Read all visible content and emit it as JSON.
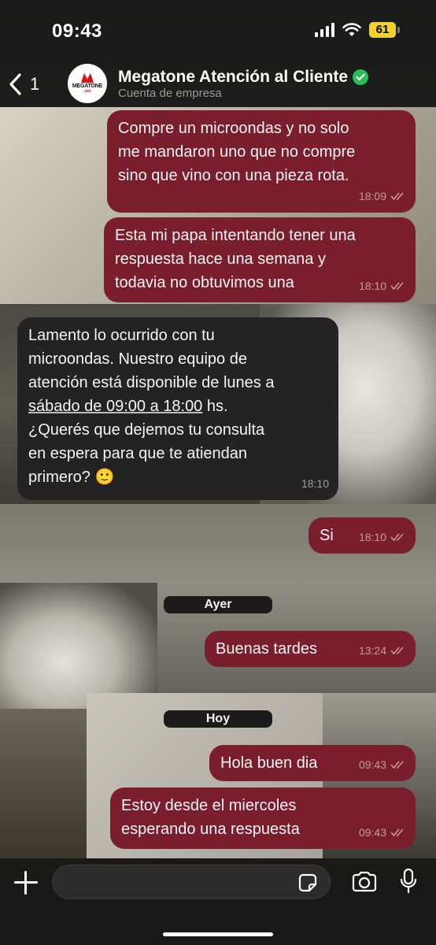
{
  "status": {
    "time": "09:43",
    "battery": "61"
  },
  "header": {
    "back_count": "1",
    "avatar_text": "MEGATONE",
    "avatar_sub": ".net",
    "name": "Megatone Atención al Cliente",
    "subtitle": "Cuenta de empresa"
  },
  "messages": [
    {
      "dir": "out",
      "text_lines": [
        "Compre un microondas y no solo",
        "me mandaron uno que no compre",
        "sino que vino con una pieza rota."
      ],
      "time": "18:09"
    },
    {
      "dir": "out",
      "text_lines": [
        "Esta mi papa intentando tener una",
        "respuesta hace una semana y",
        "todavia no obtuvimos una"
      ],
      "time": "18:10"
    },
    {
      "dir": "in",
      "text_lines": [
        "Lamento lo ocurrido con tu",
        "microondas. Nuestro equipo de",
        "atención está disponible de lunes a",
        "sábado de 09:00 a 18:00",
        "hs.",
        "¿Querés que dejemos tu consulta",
        "en espera para que te atiendan",
        "primero?",
        "🙂"
      ],
      "time": "18:10"
    },
    {
      "dir": "out",
      "text": "Si",
      "time": "18:10"
    },
    {
      "dir": "out",
      "text": "Buenas tardes",
      "time": "13:24"
    },
    {
      "dir": "out",
      "text": "Hola buen dia",
      "time": "09:43"
    },
    {
      "dir": "out",
      "text_lines": [
        "Estoy desde el miercoles",
        "esperando una respuesta"
      ],
      "time": "09:43"
    }
  ],
  "date_separators": [
    "Ayer",
    "Hoy"
  ],
  "composer": {
    "placeholder": ""
  },
  "colors": {
    "outgoing": "#7a1d2c",
    "incoming": "#232323",
    "verified": "#25c05a",
    "battery": "#f2d22a"
  }
}
